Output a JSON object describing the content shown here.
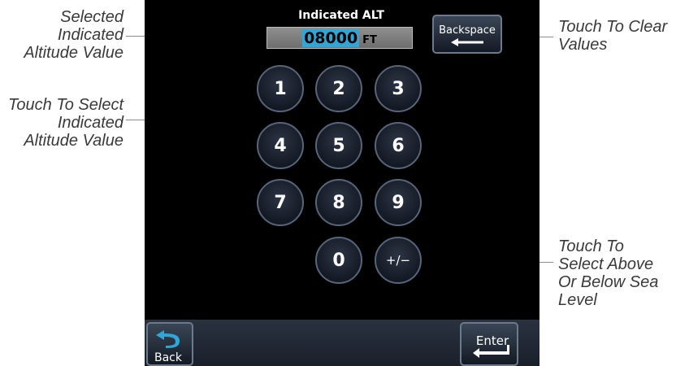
{
  "callouts": {
    "selected_value": "Selected\nIndicated\nAltitude Value",
    "select_value": "Touch To Select\nIndicated\nAltitude Value",
    "clear_values": "Touch To Clear\nValues",
    "sea_level": "Touch To\nSelect Above\nOr Below Sea\nLevel"
  },
  "screen": {
    "field_title": "Indicated ALT",
    "altitude_value": "08000",
    "altitude_unit": "FT",
    "backspace_label": "Backspace",
    "keys": [
      "1",
      "2",
      "3",
      "4",
      "5",
      "6",
      "7",
      "8",
      "9",
      "0",
      "+/−"
    ],
    "back_label": "Back",
    "enter_label": "Enter"
  },
  "colors": {
    "value_highlight": "#2fa6d6",
    "screen_background": "#000000"
  }
}
